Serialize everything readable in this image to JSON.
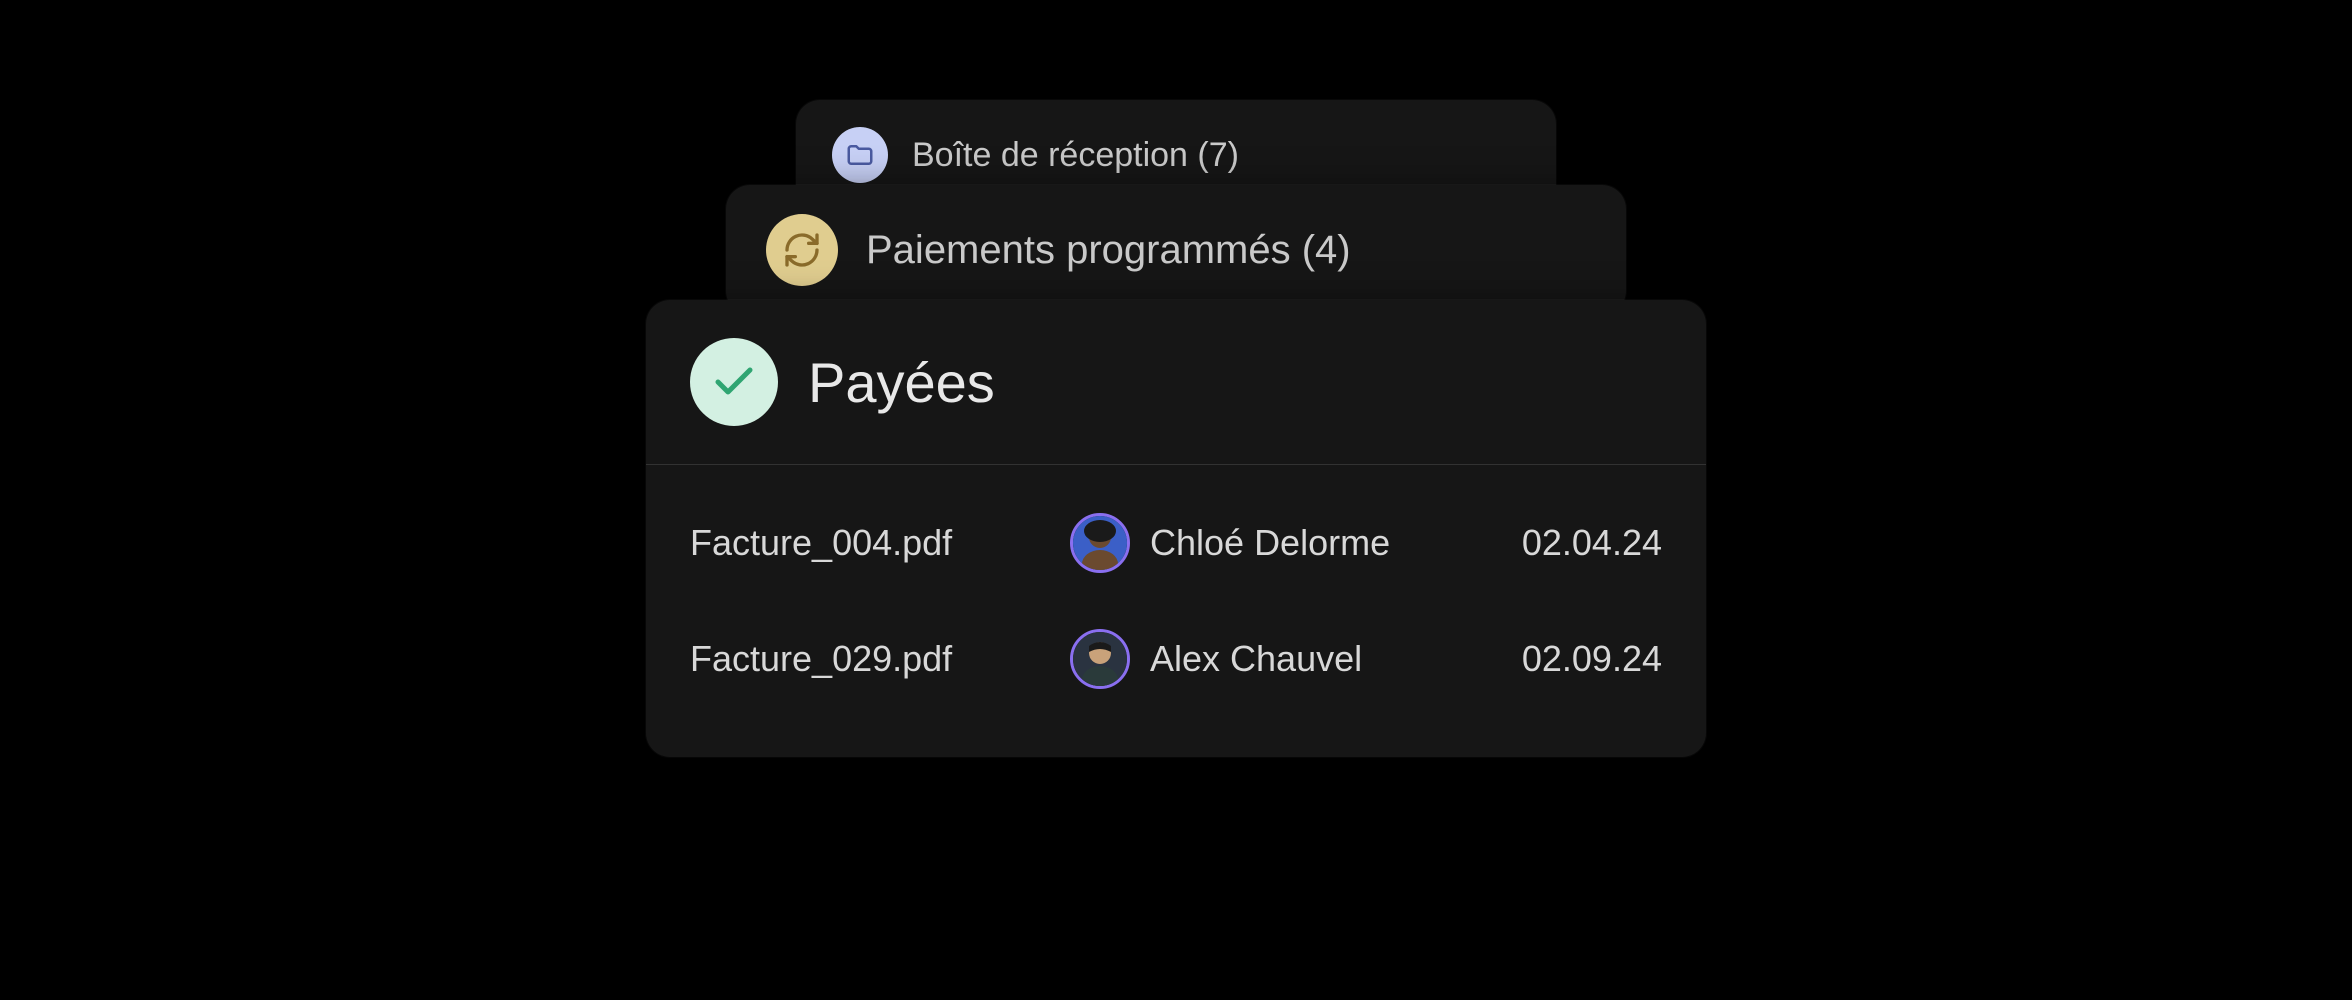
{
  "cards": {
    "inbox": {
      "icon": "folder-icon",
      "label": "Boîte de réception (7)"
    },
    "scheduled": {
      "icon": "refresh-icon",
      "label": "Paiements programmés (4)"
    },
    "paid": {
      "icon": "check-icon",
      "label": "Payées",
      "rows": [
        {
          "file": "Facture_004.pdf",
          "avatar_bg": "#3b5fc7",
          "avatar_face": "#6b4a2f",
          "name": "Chloé Delorme",
          "date": "02.04.24"
        },
        {
          "file": "Facture_029.pdf",
          "avatar_bg": "#2a3340",
          "avatar_face": "#c9a27a",
          "name": "Alex Chauvel",
          "date": "02.09.24"
        }
      ]
    }
  },
  "colors": {
    "inbox_icon_bg": "#c7d0f5",
    "inbox_icon_fg": "#4a5aa0",
    "scheduled_icon_bg": "#e0cd8f",
    "scheduled_icon_fg": "#8a6b2a",
    "paid_icon_bg": "#d3f0e2",
    "paid_icon_fg": "#2fa572"
  }
}
